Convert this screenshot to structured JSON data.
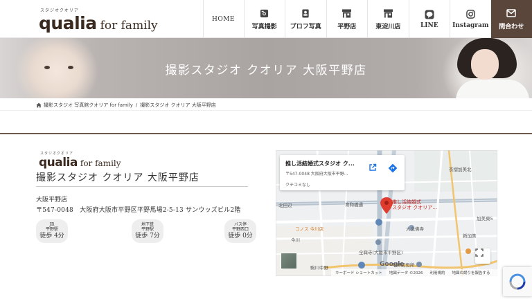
{
  "header": {
    "logo_kana": "スタジオクオリア",
    "logo_main": "qualia",
    "logo_sub": "for family"
  },
  "nav": {
    "home": "HOME",
    "photo": "写真撮影",
    "profile": "プロフ写真",
    "hirano": "平野店",
    "higashiyodogawa": "東淀川店",
    "line": "LINE",
    "instagram": "Instagram",
    "contact": "問合わせ"
  },
  "hero": {
    "title": "撮影スタジオ クオリア 大阪平野店"
  },
  "breadcrumb": {
    "home": "撮影スタジオ 写真館クオリア for family",
    "separator": "/",
    "current": "撮影スタジオ クオリア 大阪平野店"
  },
  "studio": {
    "logo_kana": "スタジオクオリア",
    "logo_main": "qualia",
    "logo_sub": "for family",
    "name": "撮影スタジオ クオリア 大阪平野店",
    "branch": "大阪平野店",
    "address": "〒547-0048　大阪府大阪市平野区平野馬場2-5-13 サンウッズビル2階",
    "access": [
      {
        "line1": "JR",
        "line2": "平野駅",
        "line3": "徒歩 4分"
      },
      {
        "line1": "地下鉄",
        "line2": "平野駅",
        "line3": "徒歩 7分"
      },
      {
        "line1": "バス停",
        "line2": "平野西口",
        "line3": "徒歩 0分"
      }
    ]
  },
  "map": {
    "card_title": "推し活結婚式スタジオ ク...",
    "card_address": "〒547-0048 大阪府大阪市平野...",
    "card_reviews": "クチコミなし",
    "pin_label_1": "推し活結婚式",
    "pin_label_2": "スタジオ クオリア…",
    "labels": {
      "kamiyabinishi": "衣摺加美北",
      "kitadebe": "北田辺",
      "ikuha": "育和橋通",
      "kasami": "加美東5",
      "daineji": "大念佛寺",
      "shinkahiden": "新加美",
      "konan": "コーナン",
      "konanshop": "コノス 今川店",
      "imagawa": "今川",
      "hiranoku": "全興寺(大阪市平野区)",
      "kuyakusho": "平野区役所",
      "komagawa": "駒川中野"
    },
    "google": "Google",
    "attribution": [
      "キーボード ショートカット",
      "地図データ ©2026",
      "利用規約",
      "地図の誤りを報告する"
    ]
  },
  "colors": {
    "brand_brown": "#5b463c",
    "rule_brown": "#6f5a4f",
    "pin_red": "#e03b2f"
  }
}
